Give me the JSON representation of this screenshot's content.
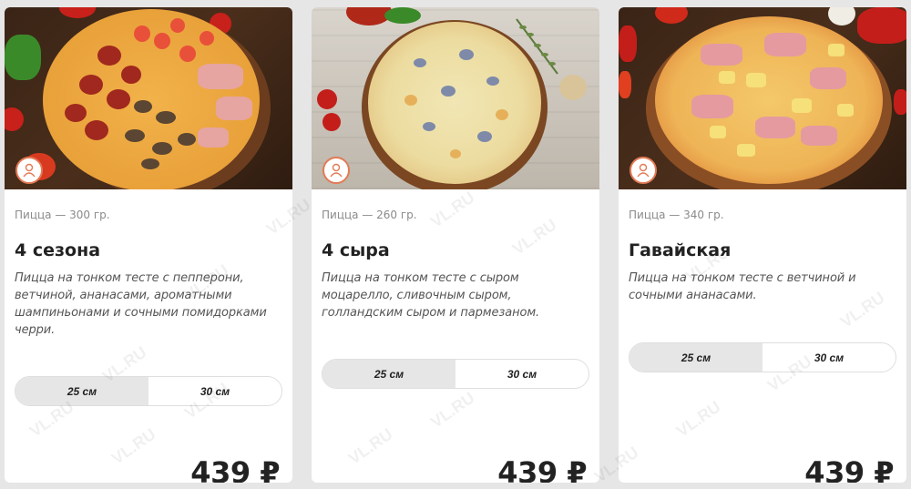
{
  "watermark": "VL.RU",
  "colors": {
    "accent": "#e37a55",
    "active_size_bg": "#e6e6e6",
    "page_bg": "#e6e6e6"
  },
  "cards": [
    {
      "weight": "Пицца — 300 гр.",
      "title": "4 сезона",
      "description": "Пицца на тонком тесте  с пепперони, ветчиной, ананасами, ароматными шампиньонами и сочными помидорками черри.",
      "sizes": [
        "25 см",
        "30 см"
      ],
      "selected_size": "25 см",
      "price": "439 ₽",
      "badge_icon": "chef-logo-icon"
    },
    {
      "weight": "Пицца — 260 гр.",
      "title": "4 сыра",
      "description": "Пицца на тонком тесте с сыром моцарелло, сливочным сыром, голландским сыром и пармезаном.",
      "sizes": [
        "25 см",
        "30 см"
      ],
      "selected_size": "25 см",
      "price": "439 ₽",
      "badge_icon": "chef-logo-icon"
    },
    {
      "weight": "Пицца — 340 гр.",
      "title": "Гавайская",
      "description": "Пицца на тонком тесте с ветчиной и сочными ананасами.",
      "sizes": [
        "25 см",
        "30 см"
      ],
      "selected_size": "25 см",
      "price": "439 ₽",
      "badge_icon": "chef-logo-icon"
    }
  ]
}
